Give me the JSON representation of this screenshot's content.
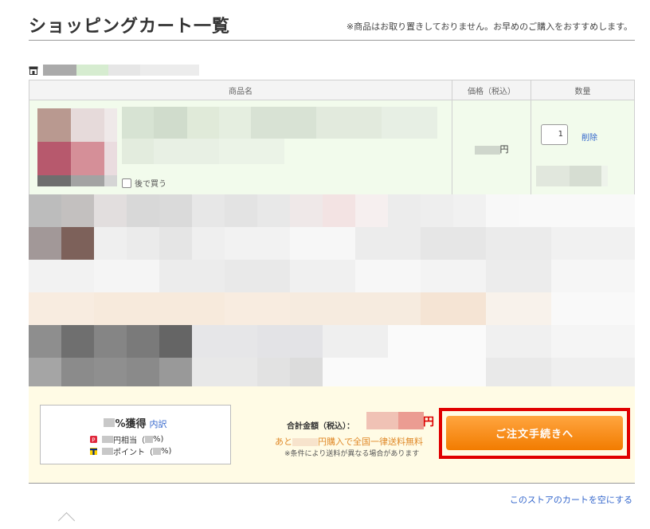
{
  "page": {
    "title": "ショッピングカート一覧",
    "notice": "※商品はお取り置きしておりません。お早めのご購入をおすすめします。"
  },
  "table": {
    "headers": [
      "商品名",
      "価格（税込）",
      "数量"
    ],
    "item": {
      "save_for_later": "後で買う",
      "price_suffix": "円",
      "quantity": "1",
      "delete_label": "削除"
    }
  },
  "footer": {
    "points": {
      "earn_suffix": "%獲得",
      "breakdown_link": "内訳",
      "line1_a": "円相当（",
      "line1_b": "%)",
      "line2_a": "ポイント（",
      "line2_b": "%)"
    },
    "total_label": "合計金額（税込）：",
    "total_suffix": "円",
    "free_shipping_a": "あと",
    "free_shipping_b": "円購入で全国一律送料無料",
    "shipping_note": "※条件により送料が異なる場合があります",
    "order_button": "ご注文手続きへ"
  },
  "empty_cart_link": "このストアのカートを空にする",
  "icons": [
    "store-icon",
    "checkbox-icon",
    "point-p-icon",
    "point-t-icon",
    "chevron-up-icon"
  ],
  "colors": {
    "accent_orange": "#f28c1e",
    "highlight_red": "#e00000",
    "row_green": "#f2fbec",
    "footer_yellow": "#fffbe5",
    "link_blue": "#3366cc"
  }
}
